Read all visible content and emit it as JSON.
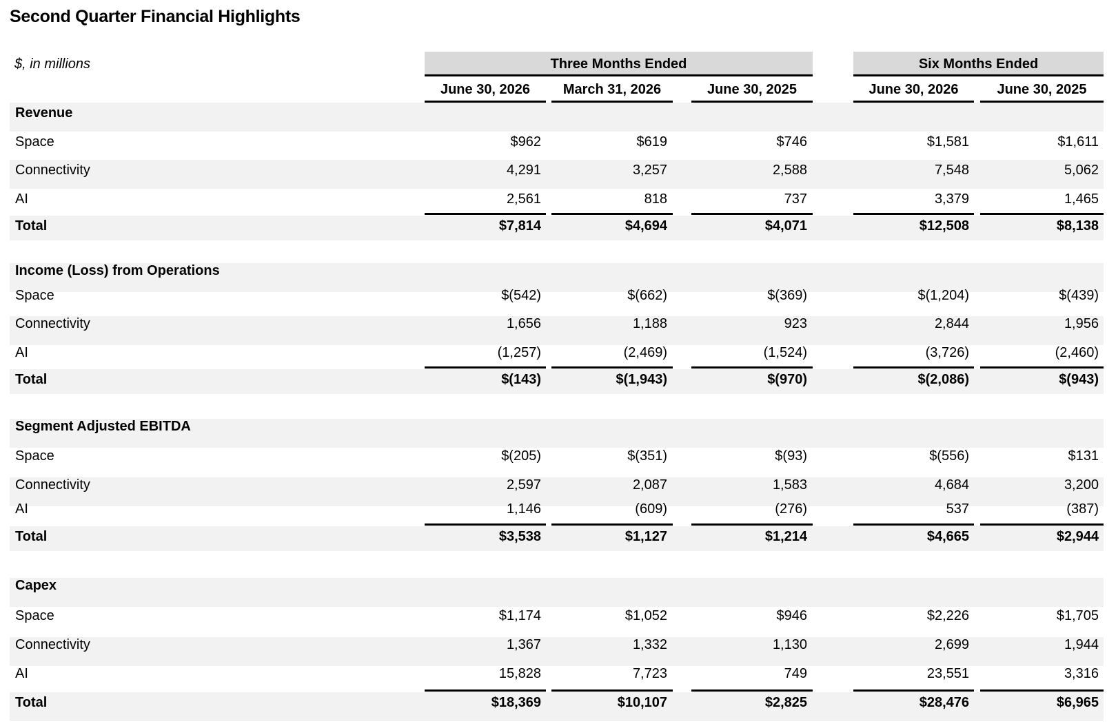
{
  "title": "Second Quarter Financial Highlights",
  "unit_note": "$, in millions",
  "column_groups": [
    "Three Months Ended",
    "Six Months Ended"
  ],
  "columns": [
    "June 30, 2026",
    "March 31, 2026",
    "June 30, 2025",
    "June 30, 2026",
    "June 30, 2025"
  ],
  "sections": [
    {
      "heading": "Revenue",
      "rows": [
        {
          "label": "Space",
          "values": [
            "$962",
            "$619",
            "$746",
            "$1,581",
            "$1,611"
          ]
        },
        {
          "label": "Connectivity",
          "values": [
            "4,291",
            "3,257",
            "2,588",
            "7,548",
            "5,062"
          ]
        },
        {
          "label": "AI",
          "values": [
            "2,561",
            "818",
            "737",
            "3,379",
            "1,465"
          ]
        }
      ],
      "total": {
        "label": "Total",
        "values": [
          "$7,814",
          "$4,694",
          "$4,071",
          "$12,508",
          "$8,138"
        ]
      }
    },
    {
      "heading": "Income (Loss) from Operations",
      "rows": [
        {
          "label": "Space",
          "values": [
            "$(542)",
            "$(662)",
            "$(369)",
            "$(1,204)",
            "$(439)"
          ]
        },
        {
          "label": "Connectivity",
          "values": [
            "1,656",
            "1,188",
            "923",
            "2,844",
            "1,956"
          ]
        },
        {
          "label": "AI",
          "values": [
            "(1,257)",
            "(2,469)",
            "(1,524)",
            "(3,726)",
            "(2,460)"
          ]
        }
      ],
      "total": {
        "label": "Total",
        "values": [
          "$(143)",
          "$(1,943)",
          "$(970)",
          "$(2,086)",
          "$(943)"
        ]
      }
    },
    {
      "heading": "Segment Adjusted EBITDA",
      "rows": [
        {
          "label": "Space",
          "values": [
            "$(205)",
            "$(351)",
            "$(93)",
            "$(556)",
            "$131"
          ]
        },
        {
          "label": "Connectivity",
          "values": [
            "2,597",
            "2,087",
            "1,583",
            "4,684",
            "3,200"
          ]
        },
        {
          "label": "AI",
          "values": [
            "1,146",
            "(609)",
            "(276)",
            "537",
            "(387)"
          ]
        }
      ],
      "total": {
        "label": "Total",
        "values": [
          "$3,538",
          "$1,127",
          "$1,214",
          "$4,665",
          "$2,944"
        ]
      }
    },
    {
      "heading": "Capex",
      "rows": [
        {
          "label": "Space",
          "values": [
            "$1,174",
            "$1,052",
            "$946",
            "$2,226",
            "$1,705"
          ]
        },
        {
          "label": "Connectivity",
          "values": [
            "1,367",
            "1,332",
            "1,130",
            "2,699",
            "1,944"
          ]
        },
        {
          "label": "AI",
          "values": [
            "15,828",
            "7,723",
            "749",
            "23,551",
            "3,316"
          ]
        }
      ],
      "total": {
        "label": "Total",
        "values": [
          "$18,369",
          "$10,107",
          "$2,825",
          "$28,476",
          "$6,965"
        ]
      }
    }
  ]
}
